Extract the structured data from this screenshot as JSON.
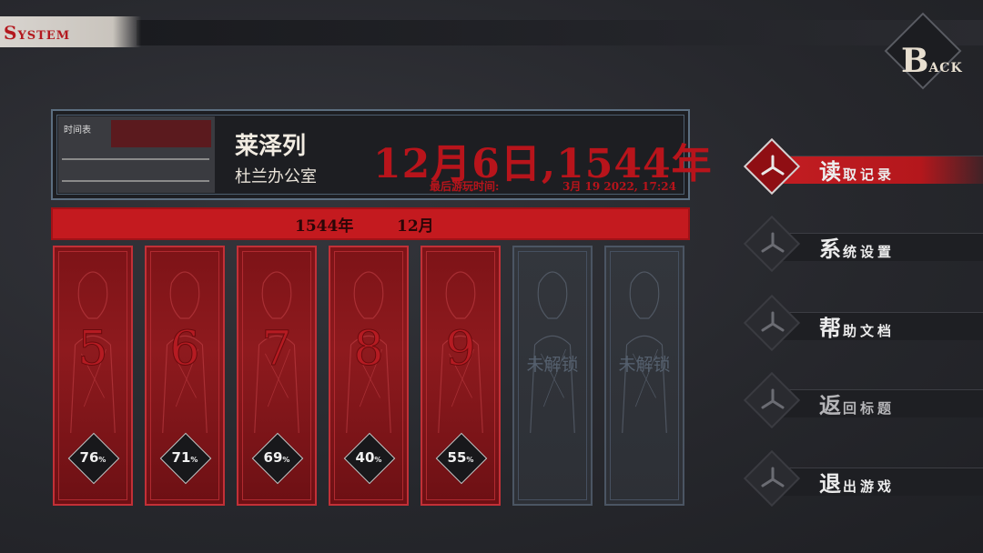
{
  "header": {
    "system_first": "S",
    "system_rest": "YSTEM",
    "back_first": "B",
    "back_rest": "ACK"
  },
  "save": {
    "thumb_label": "时间表",
    "location": "莱泽列",
    "sublocation": "杜兰办公室",
    "game_date": "12月6日,1544年",
    "last_played_label": "最后游玩时间:",
    "last_played": "3月 19 2022, 17:24"
  },
  "banner": {
    "year": "1544年",
    "month": "12月"
  },
  "chapters": [
    {
      "number": "5",
      "progress": "76",
      "unit": "%",
      "locked": false
    },
    {
      "number": "6",
      "progress": "71",
      "unit": "%",
      "locked": false
    },
    {
      "number": "7",
      "progress": "69",
      "unit": "%",
      "locked": false
    },
    {
      "number": "8",
      "progress": "40",
      "unit": "%",
      "locked": false
    },
    {
      "number": "9",
      "progress": "55",
      "unit": "%",
      "locked": false
    },
    {
      "locked_label": "未解锁",
      "locked": true
    },
    {
      "locked_label": "未解锁",
      "locked": true
    }
  ],
  "menu": [
    {
      "first": "读",
      "rest": "取记录",
      "active": true
    },
    {
      "first": "系",
      "rest": "统设置",
      "active": false
    },
    {
      "first": "帮",
      "rest": "助文档",
      "active": false
    },
    {
      "first": "返",
      "rest": "回标题",
      "active": false
    },
    {
      "first": "退",
      "rest": "出游戏",
      "active": false
    }
  ],
  "colors": {
    "accent": "#c41a1f",
    "dark_red": "#8e1a1e",
    "background": "#2a2b30"
  },
  "icons": {
    "menu": "triskelion-icon",
    "card": "percent-diamond-icon"
  }
}
